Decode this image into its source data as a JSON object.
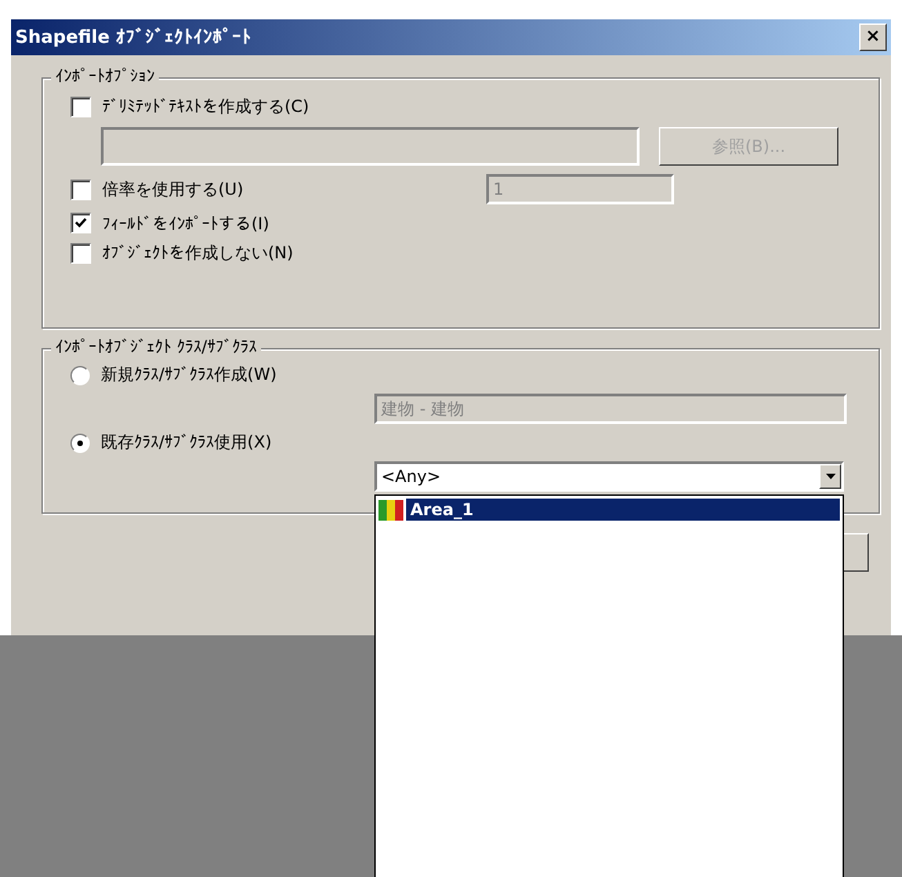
{
  "window": {
    "title": "Shapefile ｵﾌﾞｼﾞｪｸﾄｲﾝﾎﾟｰﾄ",
    "close": "×"
  },
  "import_options": {
    "legend": "ｲﾝﾎﾟｰﾄｵﾌﾟｼｮﾝ",
    "delimited": {
      "label": "ﾃﾞﾘﾐﾃｯﾄﾞﾃｷｽﾄを作成する(C)",
      "checked": false,
      "path_disabled": true,
      "browse": "参照(B)...",
      "browse_disabled": true
    },
    "scale": {
      "label": "倍率を使用する(U)",
      "checked": false,
      "value": "1",
      "value_disabled": true
    },
    "options": [
      {
        "label": "ﾌｨｰﾙﾄﾞをｲﾝﾎﾟｰﾄする(I)",
        "checked": true
      },
      {
        "label": "ｵﾌﾞｼﾞｪｸﾄを作成しない(N)",
        "checked": false
      }
    ]
  },
  "class_group": {
    "legend": "ｲﾝﾎﾟｰﾄｵﾌﾞｼﾞｪｸﾄ ｸﾗｽ/ｻﾌﾞｸﾗｽ",
    "new_class": {
      "label": "新規ｸﾗｽ/ｻﾌﾞｸﾗｽ作成(W)",
      "selected": false,
      "value": "建物 - 建物",
      "value_disabled": true
    },
    "existing_class": {
      "label": "既存ｸﾗｽ/ｻﾌﾞｸﾗｽ使用(X)",
      "selected": true,
      "combo_value": "<Any>"
    },
    "dropdown": {
      "items": [
        {
          "label": "Area_1",
          "selected": true
        }
      ]
    }
  }
}
